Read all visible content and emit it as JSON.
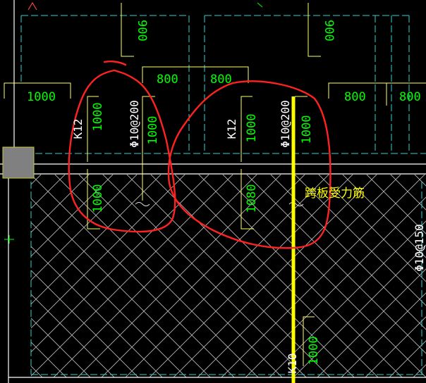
{
  "colors": {
    "background": "#000000",
    "dimension_text": "#00ff00",
    "leader": "#ffff66",
    "frame": "#ffffff",
    "cyan_dash": "#2fd0d0",
    "hatch": "#bdbdbd",
    "red_mark": "#ff2222",
    "rebar_highlight": "#ffff00",
    "annotation": "#ffff00",
    "column": "#808080"
  },
  "dimensions": {
    "top_left_900": "900",
    "top_right_900": "900",
    "mid_800_left": "800",
    "mid_800_right": "800",
    "right_800_a": "800",
    "right_800_b": "800",
    "left_1000": "1000"
  },
  "left_bar": {
    "spec": "K12",
    "upper_len": "1000",
    "lower_len": "1000",
    "spacing": "Φ10@200",
    "right_len": "1000"
  },
  "right_bar": {
    "spec": "K12",
    "upper_len": "1000",
    "lower_len": "1080",
    "spacing": "Φ10@200",
    "right_len": "1000"
  },
  "far_right_label": "Φ10@150",
  "bottom_bar": {
    "spec": "K10",
    "len": "1000"
  },
  "annotation_text": "跨板受力筋",
  "icons": [
    "column-icon",
    "arrow-mark-icon"
  ]
}
